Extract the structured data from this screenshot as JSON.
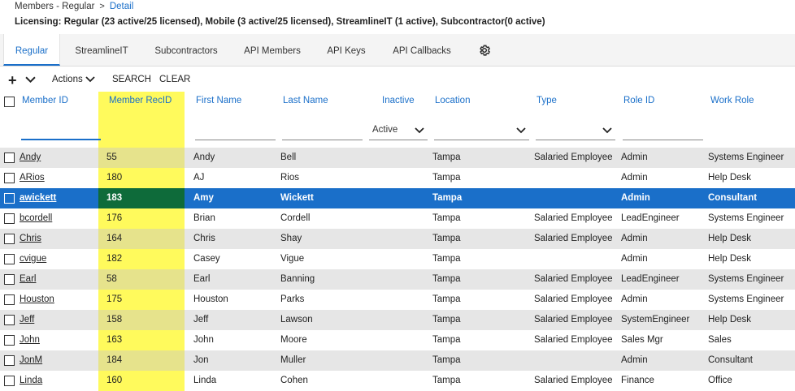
{
  "breadcrumb": {
    "parent": "Members - Regular",
    "separator": ">",
    "current": "Detail"
  },
  "licensing": "Licensing: Regular (23 active/25 licensed), Mobile (3 active/25 licensed), StreamlineIT (1 active), Subcontractor(0 active)",
  "tabs": [
    {
      "label": "Regular",
      "active": true
    },
    {
      "label": "StreamlineIT"
    },
    {
      "label": "Subcontractors"
    },
    {
      "label": "API Members"
    },
    {
      "label": "API Keys"
    },
    {
      "label": "API Callbacks"
    }
  ],
  "tab_settings_icon": "gear-icon",
  "toolbar": {
    "add_symbol": "+",
    "actions_label": "Actions",
    "search_label": "SEARCH",
    "clear_label": "CLEAR"
  },
  "columns": [
    "Member ID",
    "Member RecID",
    "First Name",
    "Last Name",
    "Inactive",
    "Location",
    "Type",
    "Role ID",
    "Work Role"
  ],
  "filters": {
    "member_id": "",
    "inactive_selected": "Active"
  },
  "highlight_color": "#fffa5c",
  "accent_color": "#1a6fc9",
  "rows": [
    {
      "member_id": "Andy",
      "recid": "55",
      "first": "Andy",
      "last": "Bell",
      "location": "Tampa",
      "type": "Salaried Employee",
      "role": "Admin",
      "work_role": "Systems Engineer"
    },
    {
      "member_id": "ARios",
      "recid": "180",
      "first": "AJ",
      "last": "Rios",
      "location": "Tampa",
      "type": "",
      "role": "Admin",
      "work_role": "Help Desk"
    },
    {
      "member_id": "awickett",
      "recid": "183",
      "first": "Amy",
      "last": "Wickett",
      "location": "Tampa",
      "type": "",
      "role": "Admin",
      "work_role": "Consultant",
      "selected": true
    },
    {
      "member_id": "bcordell",
      "recid": "176",
      "first": "Brian",
      "last": "Cordell",
      "location": "Tampa",
      "type": "Salaried Employee",
      "role": "LeadEngineer",
      "work_role": "Systems Engineer"
    },
    {
      "member_id": "Chris",
      "recid": "164",
      "first": "Chris",
      "last": "Shay",
      "location": "Tampa",
      "type": "Salaried Employee",
      "role": "Admin",
      "work_role": "Help Desk"
    },
    {
      "member_id": "cvigue",
      "recid": "182",
      "first": "Casey",
      "last": "Vigue",
      "location": "Tampa",
      "type": "",
      "role": "Admin",
      "work_role": "Help Desk"
    },
    {
      "member_id": "Earl",
      "recid": "58",
      "first": "Earl",
      "last": "Banning",
      "location": "Tampa",
      "type": "Salaried Employee",
      "role": "LeadEngineer",
      "work_role": "Systems Engineer"
    },
    {
      "member_id": "Houston",
      "recid": "175",
      "first": "Houston",
      "last": "Parks",
      "location": "Tampa",
      "type": "Salaried Employee",
      "role": "Admin",
      "work_role": "Systems Engineer"
    },
    {
      "member_id": "Jeff",
      "recid": "158",
      "first": "Jeff",
      "last": "Lawson",
      "location": "Tampa",
      "type": "Salaried Employee",
      "role": "SystemEngineer",
      "work_role": "Help Desk"
    },
    {
      "member_id": "John",
      "recid": "163",
      "first": "John",
      "last": "Moore",
      "location": "Tampa",
      "type": "Salaried Employee",
      "role": "Sales Mgr",
      "work_role": "Sales"
    },
    {
      "member_id": "JonM",
      "recid": "184",
      "first": "Jon",
      "last": "Muller",
      "location": "Tampa",
      "type": "",
      "role": "Admin",
      "work_role": "Consultant"
    },
    {
      "member_id": "Linda",
      "recid": "160",
      "first": "Linda",
      "last": "Cohen",
      "location": "Tampa",
      "type": "Salaried Employee",
      "role": "Finance",
      "work_role": "Office"
    }
  ]
}
